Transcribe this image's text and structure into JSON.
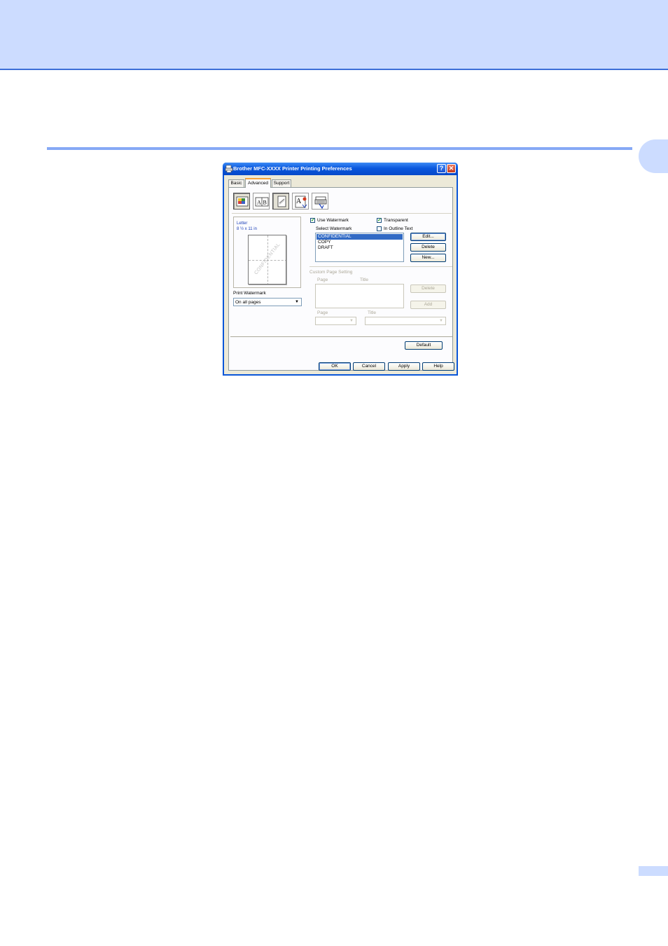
{
  "dialog": {
    "title": "Brother MFC-XXXX Printer Printing Preferences",
    "title_buttons": {
      "help": "?",
      "close": "✕"
    },
    "tabs": [
      {
        "label": "Basic",
        "active": false
      },
      {
        "label": "Advanced",
        "active": true
      },
      {
        "label": "Support",
        "active": false
      }
    ],
    "toolbar_icons": [
      "color-icon",
      "ab-scaling-icon",
      "watermark-icon",
      "text-layout-icon",
      "device-options-icon"
    ],
    "toolbar_glyphs": {
      "ab_a": "A",
      "ab_b": "B",
      "text_a": "A"
    },
    "preview": {
      "paper_name": "Letter",
      "paper_dims": "8 ½ x 11 in",
      "watermark_text": "CONFIDENTIAL"
    },
    "print_watermark": {
      "label": "Print Watermark",
      "value": "On all pages",
      "arrow": "▼"
    },
    "use_watermark": {
      "label": "Use Watermark",
      "checked": true,
      "mark": "✓"
    },
    "transparent": {
      "label": "Transparent",
      "checked": true,
      "mark": "✓"
    },
    "outline_text": {
      "label": "In Outline Text",
      "checked": false
    },
    "select_watermark": {
      "label": "Select Watermark",
      "items": [
        "CONFIDENTIAL",
        "COPY",
        "DRAFT"
      ],
      "selected_index": 0
    },
    "watermark_buttons": {
      "edit": "Edit...",
      "delete": "Delete",
      "new": "New..."
    },
    "custom_page": {
      "group_label": "Custom Page Setting",
      "page_col": "Page",
      "title_col": "Title",
      "delete_button": "Delete",
      "add_button": "Add",
      "page_label": "Page",
      "title_label": "Title",
      "arrow": "▼"
    },
    "default_button": "Default",
    "footer_buttons": {
      "ok": "OK",
      "cancel": "Cancel",
      "apply": "Apply",
      "help": "Help"
    },
    "colors": {
      "titlebar": "#0a58de",
      "selection": "#316ac5",
      "face": "#ece9d8"
    }
  }
}
